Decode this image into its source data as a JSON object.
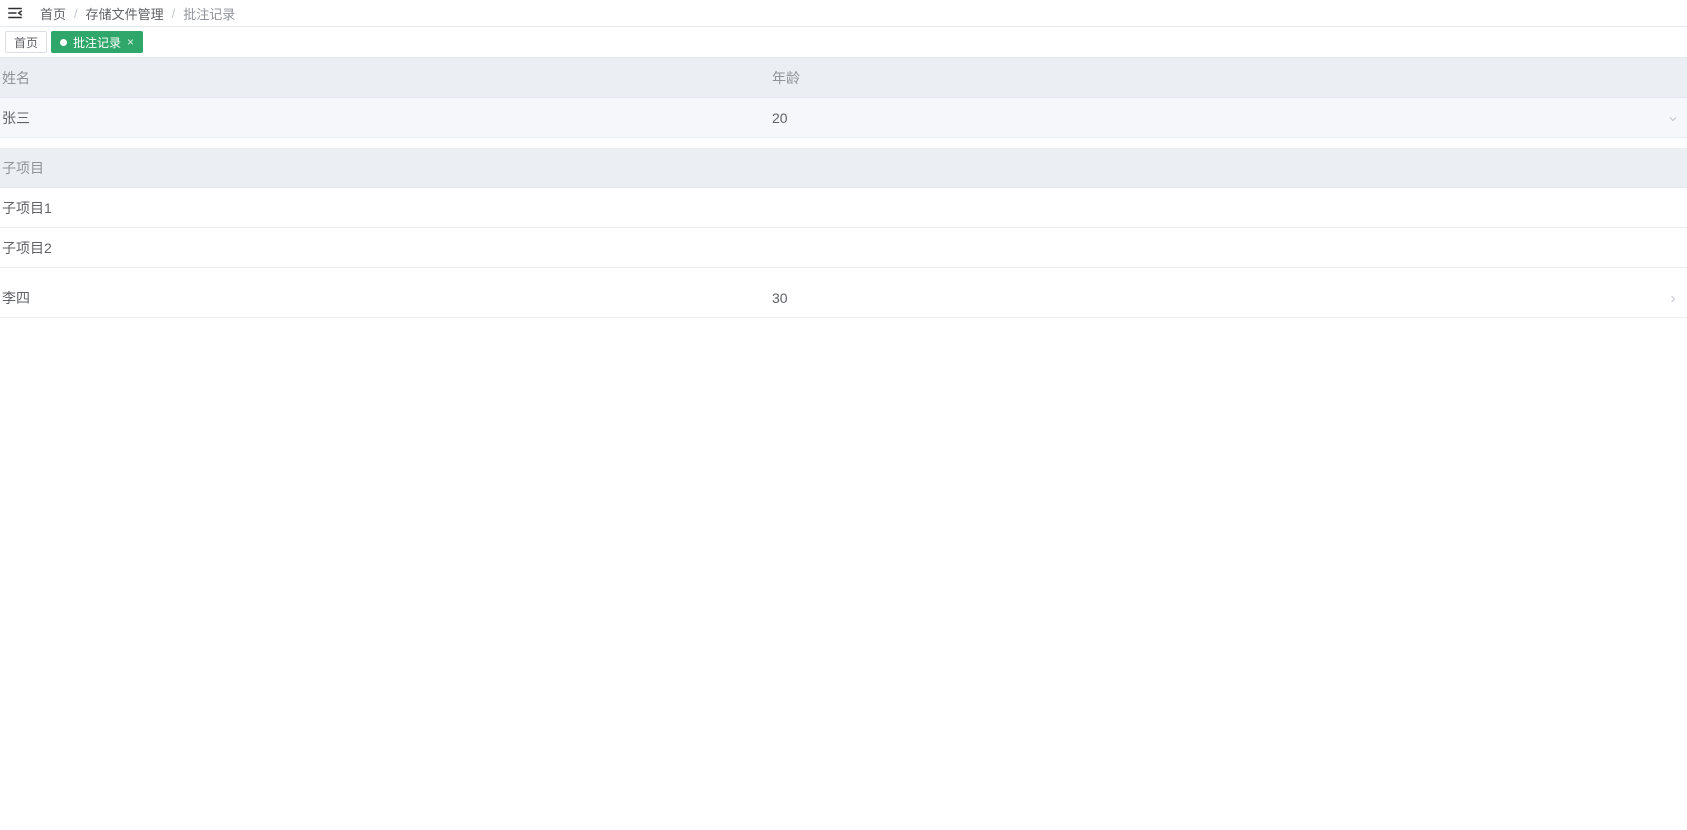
{
  "breadcrumb": {
    "home": "首页",
    "middle": "存储文件管理",
    "current": "批注记录"
  },
  "tabs": [
    {
      "label": "首页",
      "active": false
    },
    {
      "label": "批注记录",
      "active": true
    }
  ],
  "table": {
    "columns": {
      "name": "姓名",
      "age": "年龄"
    },
    "rows": [
      {
        "name": "张三",
        "age": "20",
        "expanded": true,
        "sub_header": "子项目",
        "sub_items": [
          "子项目1",
          "子项目2"
        ]
      },
      {
        "name": "李四",
        "age": "30",
        "expanded": false
      }
    ]
  }
}
